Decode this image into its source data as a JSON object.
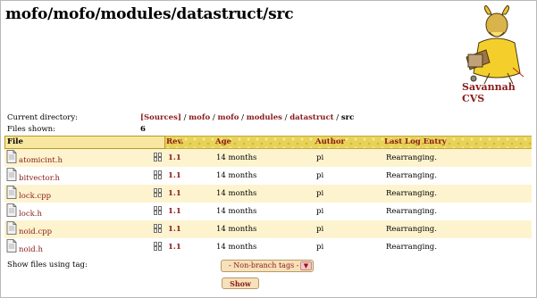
{
  "page": {
    "title": "mofo/mofo/modules/datastruct/src",
    "logo_text": "Savannah CVS"
  },
  "meta": {
    "current_dir_label": "Current directory:",
    "files_shown_label": "Files shown:",
    "files_shown_value": "6",
    "breadcrumb": [
      {
        "label": "[Sources]",
        "link": true
      },
      {
        "label": "mofo",
        "link": true
      },
      {
        "label": "mofo",
        "link": true
      },
      {
        "label": "modules",
        "link": true
      },
      {
        "label": "datastruct",
        "link": true
      },
      {
        "label": "src",
        "link": false
      }
    ],
    "sep": " / "
  },
  "table": {
    "headers": {
      "file": "File",
      "rev": "Rev.",
      "age": "Age",
      "author": "Author",
      "log": "Last Log Entry"
    },
    "rows": [
      {
        "file": "atomicint.h",
        "rev": "1.1",
        "age": "14 months",
        "author": "pi",
        "log": "Rearranging."
      },
      {
        "file": "bitvector.h",
        "rev": "1.1",
        "age": "14 months",
        "author": "pi",
        "log": "Rearranging."
      },
      {
        "file": "lock.cpp",
        "rev": "1.1",
        "age": "14 months",
        "author": "pi",
        "log": "Rearranging."
      },
      {
        "file": "lock.h",
        "rev": "1.1",
        "age": "14 months",
        "author": "pi",
        "log": "Rearranging."
      },
      {
        "file": "noid.cpp",
        "rev": "1.1",
        "age": "14 months",
        "author": "pi",
        "log": "Rearranging."
      },
      {
        "file": "noid.h",
        "rev": "1.1",
        "age": "14 months",
        "author": "pi",
        "log": "Rearranging."
      }
    ]
  },
  "controls": {
    "tag_label": "Show files using tag:",
    "tag_select_value": "- Non-branch tags -",
    "show_button": "Show"
  },
  "icons": {
    "file": "file-icon",
    "log": "log-icon",
    "arrow": "dropdown-arrow-icon",
    "logo": "gnu-logo-icon"
  },
  "colors": {
    "link": "#8b1a1a",
    "header_bg": "#e8d35a",
    "row_alt": "#fdf4cf"
  }
}
